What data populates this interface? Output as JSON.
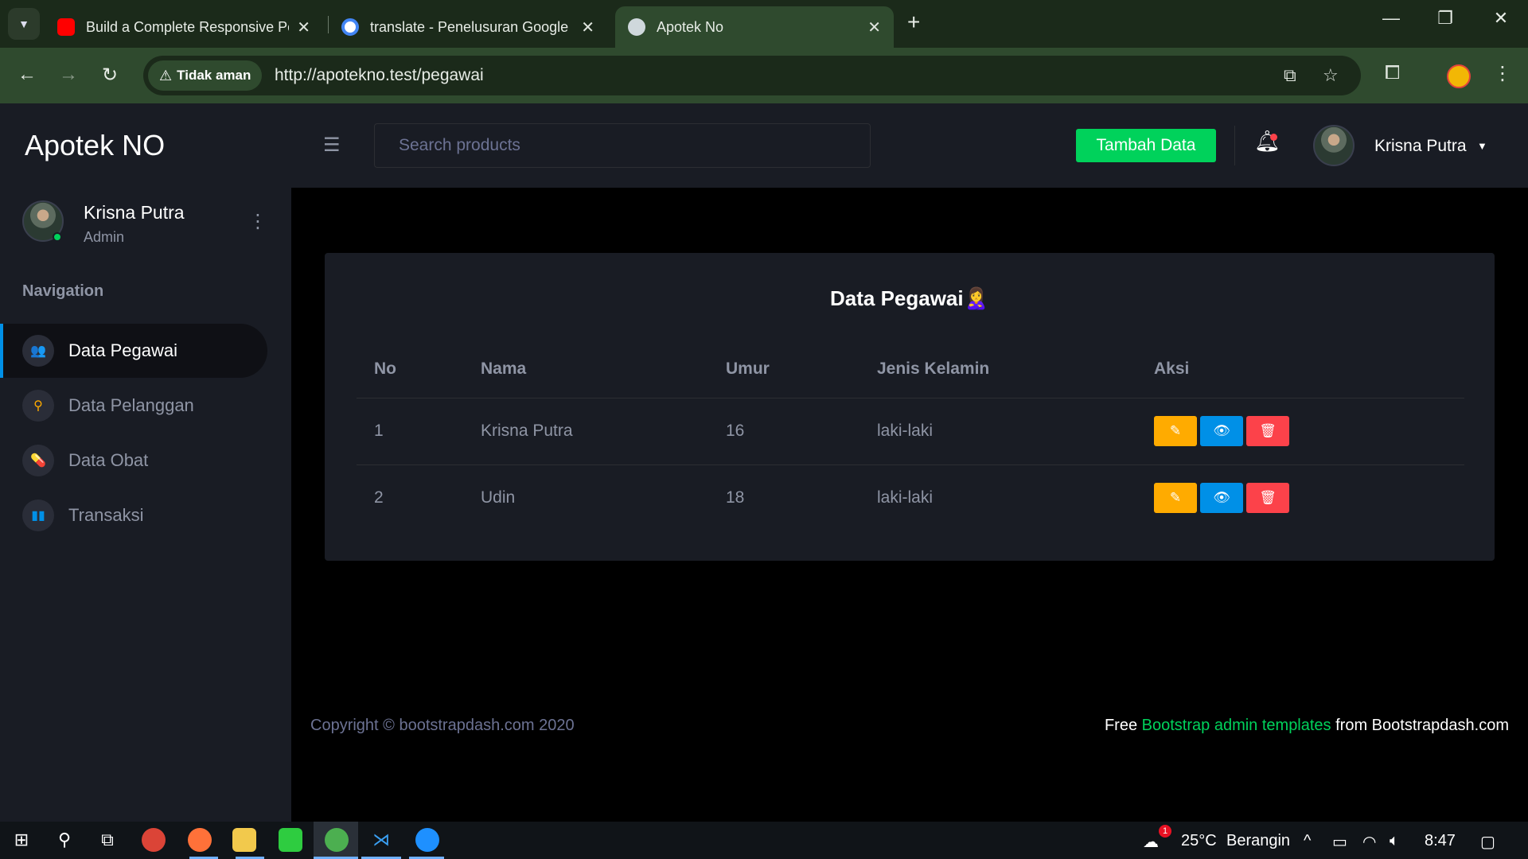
{
  "browser": {
    "tabs": [
      {
        "title": "Build a Complete Responsive Pe",
        "icon": "youtube-icon",
        "color": "#ff0000"
      },
      {
        "title": "translate - Penelusuran Google",
        "icon": "google-icon",
        "color": "#4285f4"
      },
      {
        "title": "Apotek No",
        "icon": "site-icon",
        "color": "#cfd8dc"
      }
    ],
    "security_label": "Tidak aman",
    "url": "http://apotekno.test/pegawai"
  },
  "app": {
    "brand": "Apotek NO",
    "search_placeholder": "Search products",
    "add_button": "Tambah Data",
    "top_user": "Krisna Putra"
  },
  "sidebar": {
    "user_name": "Krisna Putra",
    "user_role": "Admin",
    "nav_title": "Navigation",
    "items": [
      {
        "label": "Data Pegawai",
        "icon": "users-icon",
        "color": "#8f5fe8"
      },
      {
        "label": "Data Pelanggan",
        "icon": "user-search-icon",
        "color": "#ffab00"
      },
      {
        "label": "Data Obat",
        "icon": "pill-icon",
        "color": "#fc424a"
      },
      {
        "label": "Transaksi",
        "icon": "chart-icon",
        "color": "#0090e7"
      }
    ]
  },
  "card": {
    "title": "Data Pegawai🙎‍♀️",
    "headers": [
      "No",
      "Nama",
      "Umur",
      "Jenis Kelamin",
      "Aksi"
    ],
    "rows": [
      {
        "no": "1",
        "nama": "Krisna Putra",
        "umur": "16",
        "jk": "laki-laki"
      },
      {
        "no": "2",
        "nama": "Udin",
        "umur": "18",
        "jk": "laki-laki"
      }
    ]
  },
  "footer": {
    "copyright": "Copyright © bootstrapdash.com 2020",
    "right_prefix": "Free ",
    "right_link": "Bootstrap admin templates",
    "right_suffix": " from Bootstrapdash.com"
  },
  "taskbar": {
    "temperature": "25°C",
    "weather": "Berangin",
    "time": "8:47",
    "weather_badge": "1"
  }
}
